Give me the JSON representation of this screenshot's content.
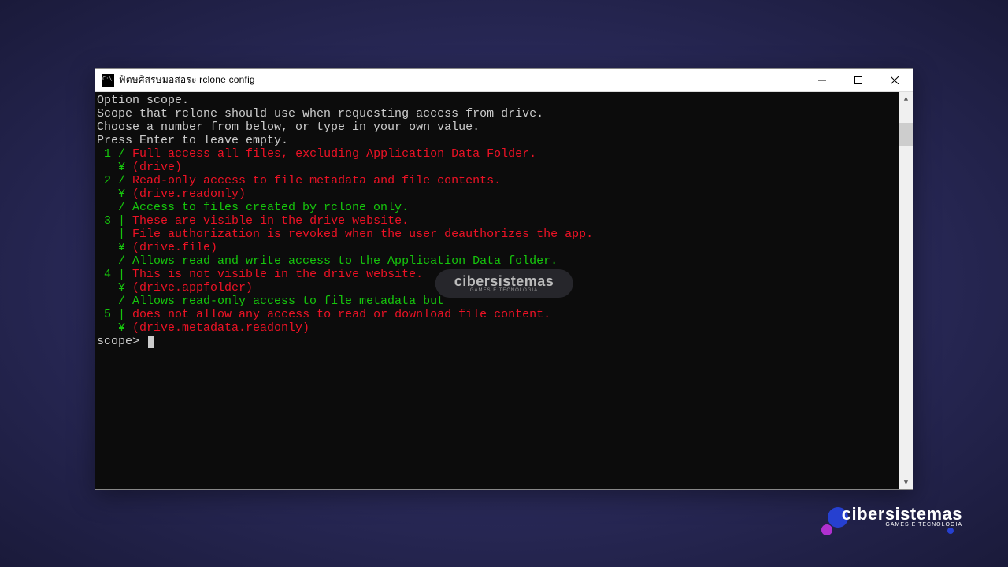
{
  "window": {
    "title": "ฟ้ตษศิสรษมอสอระ  rclone  config"
  },
  "terminal": {
    "lines": [
      {
        "text": "Option scope.",
        "color": "c-white"
      },
      {
        "text": "Scope that rclone should use when requesting access from drive.",
        "color": "c-white"
      },
      {
        "text": "Choose a number from below, or type in your own value.",
        "color": "c-white"
      },
      {
        "text": "Press Enter to leave empty.",
        "color": "c-white"
      }
    ],
    "options": [
      {
        "num": "1",
        "sep1": " / ",
        "desc": [
          "Full access all files, excluding Application Data Folder."
        ],
        "value_prefix": "   ¥ ",
        "value": "(drive)"
      },
      {
        "num": "2",
        "sep1": " / ",
        "desc": [
          "Read-only access to file metadata and file contents."
        ],
        "value_prefix": "   ¥ ",
        "value": "(drive.readonly)"
      },
      {
        "num": "3",
        "sep1": " | ",
        "pre": "   / Access to files created by rclone only.",
        "desc": [
          "These are visible in the drive website.",
          "File authorization is revoked when the user deauthorizes the app."
        ],
        "midsep": "   | ",
        "value_prefix": "   ¥ ",
        "value": "(drive.file)"
      },
      {
        "num": "4",
        "sep1": " | ",
        "pre": "   / Allows read and write access to the Application Data folder.",
        "desc": [
          "This is not visible in the drive website."
        ],
        "value_prefix": "   ¥ ",
        "value": "(drive.appfolder)"
      },
      {
        "num": "5",
        "sep1": " | ",
        "pre": "   / Allows read-only access to file metadata but",
        "desc": [
          "does not allow any access to read or download file content."
        ],
        "value_prefix": "   ¥ ",
        "value": "(drive.metadata.readonly)"
      }
    ],
    "prompt": "scope> "
  },
  "watermark": {
    "text": "cibersistemas",
    "sub": "GAMES E TECNOLOGIA"
  }
}
